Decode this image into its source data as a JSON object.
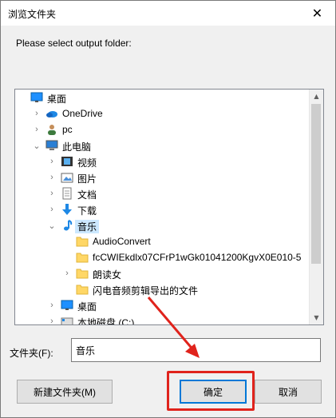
{
  "window": {
    "title": "浏览文件夹",
    "close_glyph": "✕"
  },
  "prompt": "Please select output folder:",
  "tree": {
    "items": [
      {
        "label": "桌面",
        "icon": "desktop-icon",
        "chevron": ""
      },
      {
        "label": "OneDrive",
        "icon": "onedrive-icon",
        "chevron": ">"
      },
      {
        "label": "pc",
        "icon": "user-icon",
        "chevron": ">"
      },
      {
        "label": "此电脑",
        "icon": "computer-icon",
        "chevron": "v"
      },
      {
        "label": "视频",
        "icon": "video-folder-icon",
        "chevron": ">"
      },
      {
        "label": "图片",
        "icon": "pictures-folder-icon",
        "chevron": ">"
      },
      {
        "label": "文档",
        "icon": "documents-folder-icon",
        "chevron": ">"
      },
      {
        "label": "下载",
        "icon": "download-folder-icon",
        "chevron": ">"
      },
      {
        "label": "音乐",
        "icon": "music-folder-icon",
        "chevron": "v",
        "selected": true
      },
      {
        "label": "AudioConvert",
        "icon": "folder-icon",
        "chevron": ""
      },
      {
        "label": "fcCWIEkdlx07CFrP1wGk01041200KgvX0E010-5",
        "icon": "folder-icon",
        "chevron": ""
      },
      {
        "label": "朗读女",
        "icon": "folder-icon",
        "chevron": ">"
      },
      {
        "label": "闪电音频剪辑导出的文件",
        "icon": "folder-icon",
        "chevron": ""
      },
      {
        "label": "桌面",
        "icon": "desktop-icon",
        "chevron": ">"
      },
      {
        "label": "本地磁盘 (C:)",
        "icon": "drive-icon",
        "chevron": ">"
      }
    ]
  },
  "folder_field": {
    "label": "文件夹(F):",
    "value": "音乐"
  },
  "buttons": {
    "new_folder": "新建文件夹(M)",
    "ok": "确定",
    "cancel": "取消"
  },
  "colors": {
    "accent": "#0078d7",
    "selection": "#cce8ff",
    "annotation": "#e0231c",
    "folder": "#ffd766"
  }
}
